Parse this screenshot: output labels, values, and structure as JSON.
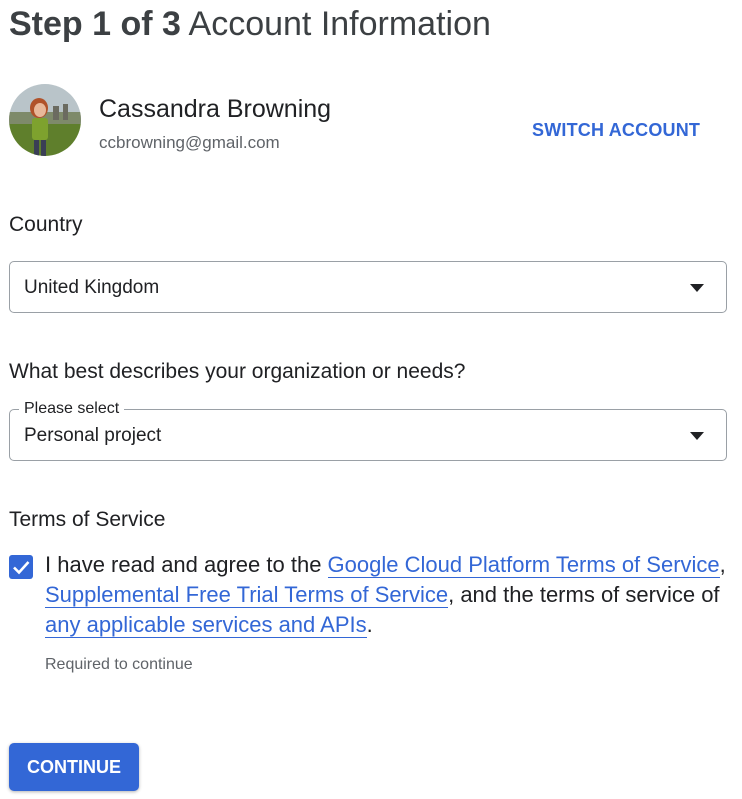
{
  "header": {
    "step_label": "Step 1 of 3",
    "title": "Account Information"
  },
  "account": {
    "name": "Cassandra Browning",
    "email": "ccbrowning@gmail.com",
    "avatar_icon": "profile-photo",
    "switch_label": "SWITCH ACCOUNT"
  },
  "country": {
    "heading": "Country",
    "selected": "United Kingdom",
    "icon": "dropdown-arrow-icon"
  },
  "organization": {
    "heading": "What best describes your organization or needs?",
    "label": "Please select",
    "selected": "Personal project",
    "icon": "dropdown-arrow-icon"
  },
  "terms": {
    "heading": "Terms of Service",
    "checked": true,
    "text_before": "I have read and agree to the ",
    "link_gcp_terms": "Google Cloud Platform Terms of Service",
    "separator": ", ",
    "link_free_trial_terms": "Supplemental Free Trial Terms of Service",
    "text_middle": ", and the terms of service of ",
    "link_applicable": "any applicable services and APIs",
    "text_after": ".",
    "helper": "Required to continue"
  },
  "actions": {
    "continue_label": "CONTINUE"
  },
  "colors": {
    "accent": "#3367d6",
    "text": "#202124",
    "muted": "#5f6368",
    "border": "#9aa0a6"
  }
}
